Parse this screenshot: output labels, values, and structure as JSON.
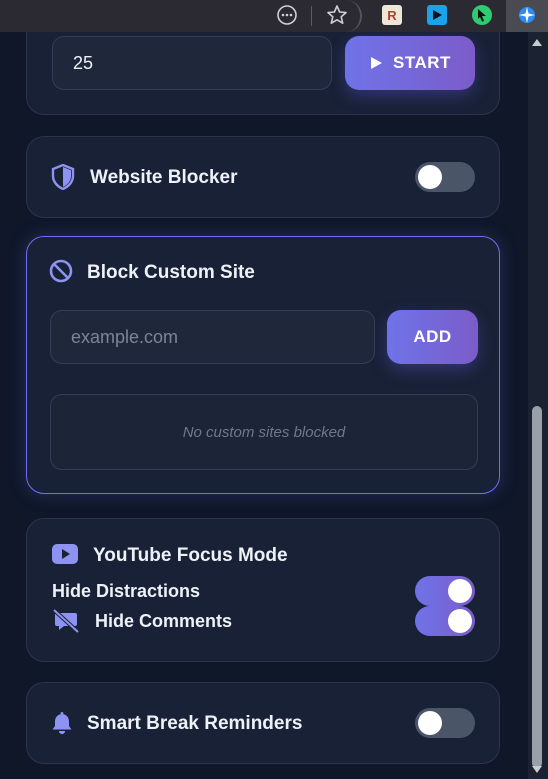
{
  "timer": {
    "value": "25",
    "start_label": "START"
  },
  "website_blocker": {
    "title": "Website Blocker",
    "enabled": false
  },
  "custom_site": {
    "title": "Block Custom Site",
    "placeholder": "example.com",
    "add_label": "ADD",
    "empty_text": "No custom sites blocked"
  },
  "youtube": {
    "title": "YouTube Focus Mode",
    "hide_distractions_label": "Hide Distractions",
    "hide_distractions_enabled": true,
    "hide_comments_label": "Hide Comments",
    "hide_comments_enabled": true
  },
  "break_reminders": {
    "title": "Smart Break Reminders",
    "enabled": false
  },
  "browser": {
    "extensions": [
      {
        "icon": "r-extension-icon",
        "letter": "R",
        "bg": "#efe6d8",
        "fg": "#c0392b"
      },
      {
        "icon": "play-extension-icon",
        "letter": "",
        "bg": "#1aa3e8",
        "fg": "#000000"
      },
      {
        "icon": "cursor-extension-icon",
        "letter": "",
        "bg": "#2ecc71",
        "fg": "#000000"
      },
      {
        "icon": "globe-extension-icon",
        "letter": "",
        "bg": "#4a4a52",
        "fg": "#2d8cf0"
      }
    ]
  },
  "colors": {
    "background": "#0f1729",
    "card": "#182136",
    "accent_start": "#6f73e8",
    "accent_end": "#7b5cc9",
    "icon": "#8e93f2"
  }
}
